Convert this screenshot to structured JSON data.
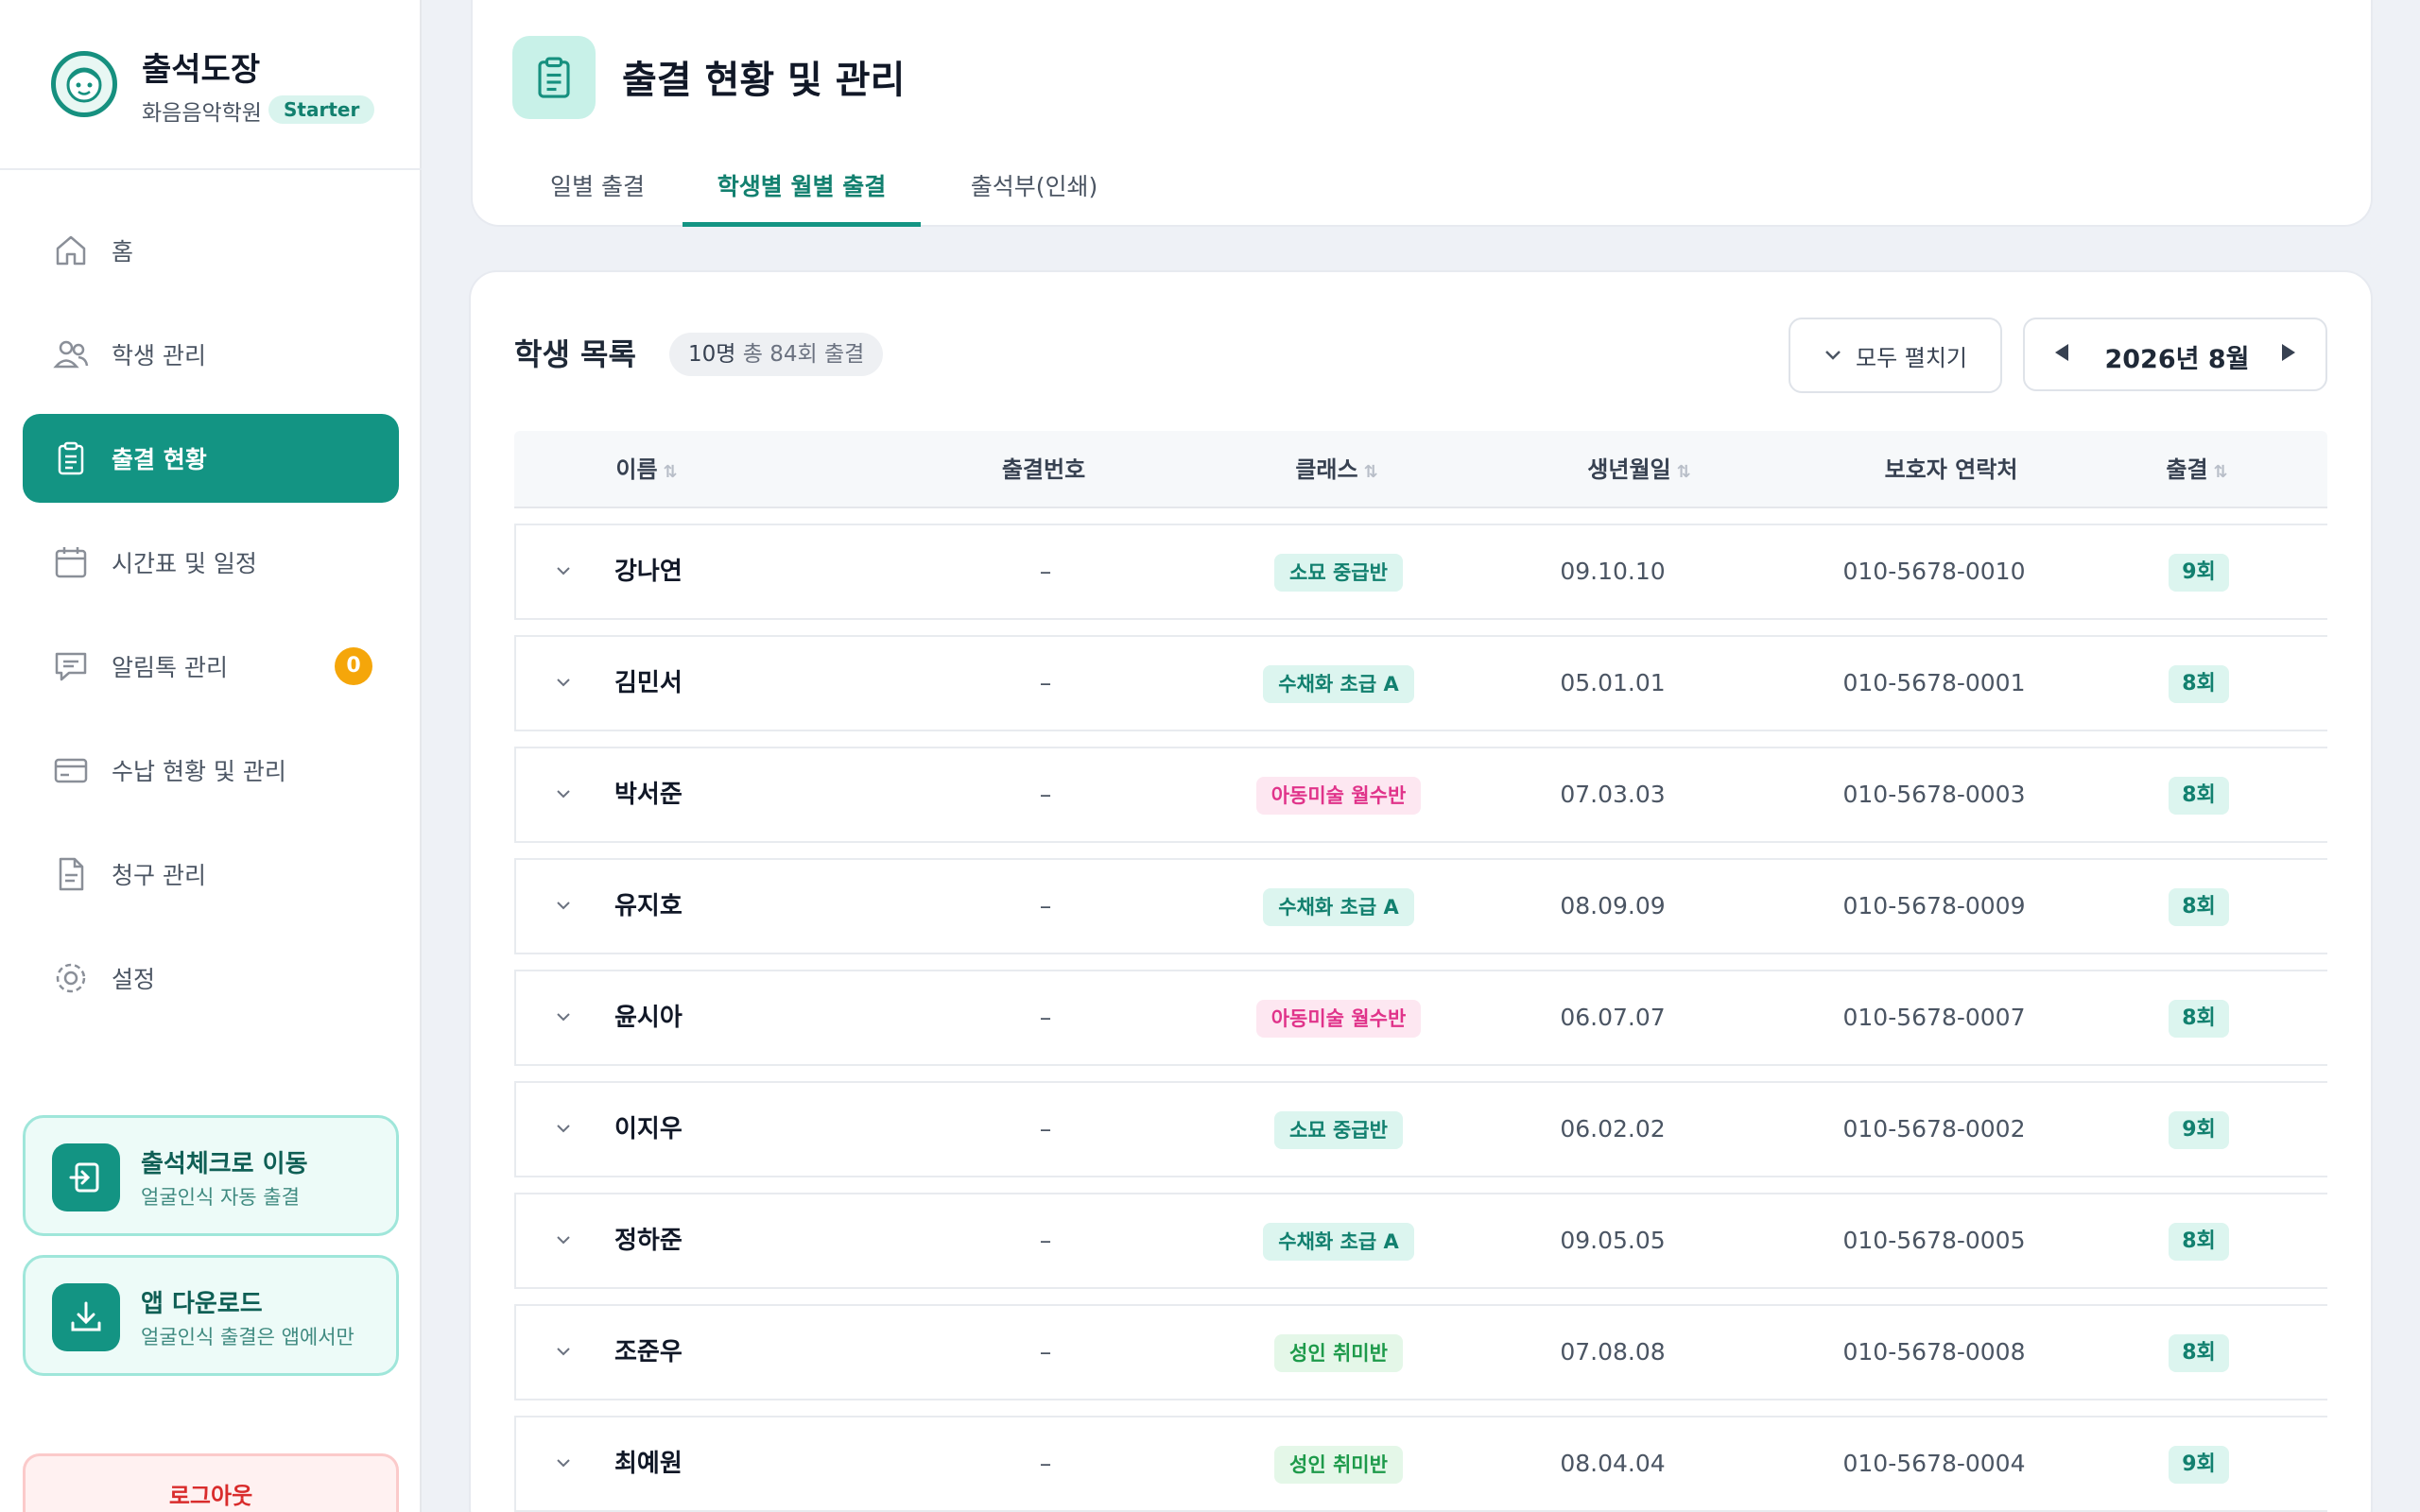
{
  "app": {
    "name": "출석도장",
    "academy": "화음음악학원",
    "plan": "Starter"
  },
  "sidebar": {
    "items": [
      {
        "label": "홈",
        "icon": "home-icon"
      },
      {
        "label": "학생 관리",
        "icon": "users-icon"
      },
      {
        "label": "출결 현황",
        "icon": "clipboard-icon",
        "active": true
      },
      {
        "label": "시간표 및 일정",
        "icon": "calendar-icon"
      },
      {
        "label": "알림톡 관리",
        "icon": "chat-icon",
        "badge": "0"
      },
      {
        "label": "수납 현황 및 관리",
        "icon": "card-icon"
      },
      {
        "label": "청구 관리",
        "icon": "document-icon"
      },
      {
        "label": "설정",
        "icon": "gear-icon"
      }
    ],
    "promo_checkin": {
      "title": "출석체크로 이동",
      "subtitle": "얼굴인식 자동 출결"
    },
    "promo_app": {
      "title": "앱 다운로드",
      "subtitle": "얼굴인식 출결은 앱에서만"
    },
    "logout": "로그아웃"
  },
  "header": {
    "title": "출결 현황 및 관리",
    "tabs": [
      {
        "label": "일별 출결"
      },
      {
        "label": "학생별 월별 출결",
        "active": true
      },
      {
        "label": "출석부(인쇄)"
      }
    ]
  },
  "list": {
    "title": "학생 목록",
    "count_students": "10명",
    "count_total": "총 84회 출결",
    "expand_all": "모두 펼치기",
    "month": "2026년 8월",
    "columns": [
      "이름",
      "출결번호",
      "클래스",
      "생년월일",
      "보호자 연락처",
      "출결"
    ],
    "rows": [
      {
        "name": "강나연",
        "number": "–",
        "class": "소묘 중급반",
        "class_color": "teal",
        "birth": "09.10.10",
        "phone": "010-5678-0010",
        "attendance": "9회"
      },
      {
        "name": "김민서",
        "number": "–",
        "class": "수채화 초급 A",
        "class_color": "teal",
        "birth": "05.01.01",
        "phone": "010-5678-0001",
        "attendance": "8회"
      },
      {
        "name": "박서준",
        "number": "–",
        "class": "아동미술 월수반",
        "class_color": "pink",
        "birth": "07.03.03",
        "phone": "010-5678-0003",
        "attendance": "8회"
      },
      {
        "name": "유지호",
        "number": "–",
        "class": "수채화 초급 A",
        "class_color": "teal",
        "birth": "08.09.09",
        "phone": "010-5678-0009",
        "attendance": "8회"
      },
      {
        "name": "윤시아",
        "number": "–",
        "class": "아동미술 월수반",
        "class_color": "pink",
        "birth": "06.07.07",
        "phone": "010-5678-0007",
        "attendance": "8회"
      },
      {
        "name": "이지우",
        "number": "–",
        "class": "소묘 중급반",
        "class_color": "teal",
        "birth": "06.02.02",
        "phone": "010-5678-0002",
        "attendance": "9회"
      },
      {
        "name": "정하준",
        "number": "–",
        "class": "수채화 초급 A",
        "class_color": "teal",
        "birth": "09.05.05",
        "phone": "010-5678-0005",
        "attendance": "8회"
      },
      {
        "name": "조준우",
        "number": "–",
        "class": "성인 취미반",
        "class_color": "green",
        "birth": "07.08.08",
        "phone": "010-5678-0008",
        "attendance": "8회"
      },
      {
        "name": "최예원",
        "number": "–",
        "class": "성인 취미반",
        "class_color": "green",
        "birth": "08.04.04",
        "phone": "010-5678-0004",
        "attendance": "9회"
      }
    ]
  }
}
